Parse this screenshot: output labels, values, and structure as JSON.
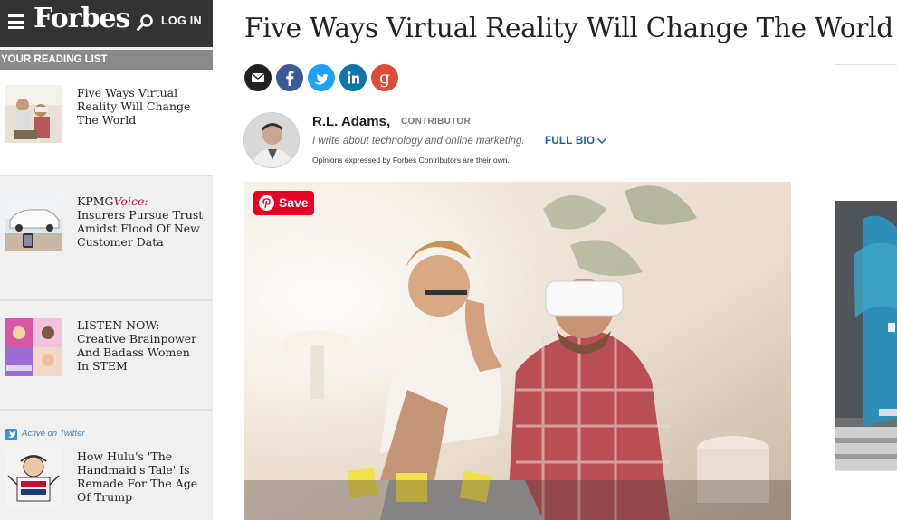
{
  "header": {
    "logo": "Forbes",
    "login_label": "LOG IN"
  },
  "reading_list": {
    "header": "YOUR READING LIST",
    "items": [
      {
        "title": "Five Ways Virtual Reality Will Change The World"
      },
      {
        "prefix": "KPMG",
        "voice": "Voice:",
        "title": "Insurers Pursue Trust Amidst Flood Of New Customer Data"
      },
      {
        "title": "LISTEN NOW: Creative Brainpower And Badass Women In STEM"
      },
      {
        "badge": "Active on Twitter",
        "title": "How Hulu's 'The Handmaid's Tale' Is Remade For The Age Of Trump"
      }
    ]
  },
  "article": {
    "title": "Five Ways Virtual Reality Will Change The World",
    "author": {
      "name": "R.L. Adams,",
      "role": "CONTRIBUTOR",
      "description": "I write about technology and online marketing.",
      "full_bio_label": "FULL BIO",
      "disclaimer": "Opinions expressed by Forbes Contributors are their own."
    },
    "save_label": "Save"
  },
  "share_icons": [
    "email-icon",
    "facebook-icon",
    "twitter-icon",
    "linkedin-icon",
    "google-plus-icon"
  ],
  "colors": {
    "topbar": "#333333",
    "reading_list_header": "#8a8a8a",
    "facebook": "#3b5998",
    "twitter": "#1da1f2",
    "linkedin": "#0e76a8",
    "google": "#dd4b39",
    "pinterest": "#e60023",
    "link": "#1a5fa8",
    "kpmg_voice": "#c8102e"
  }
}
